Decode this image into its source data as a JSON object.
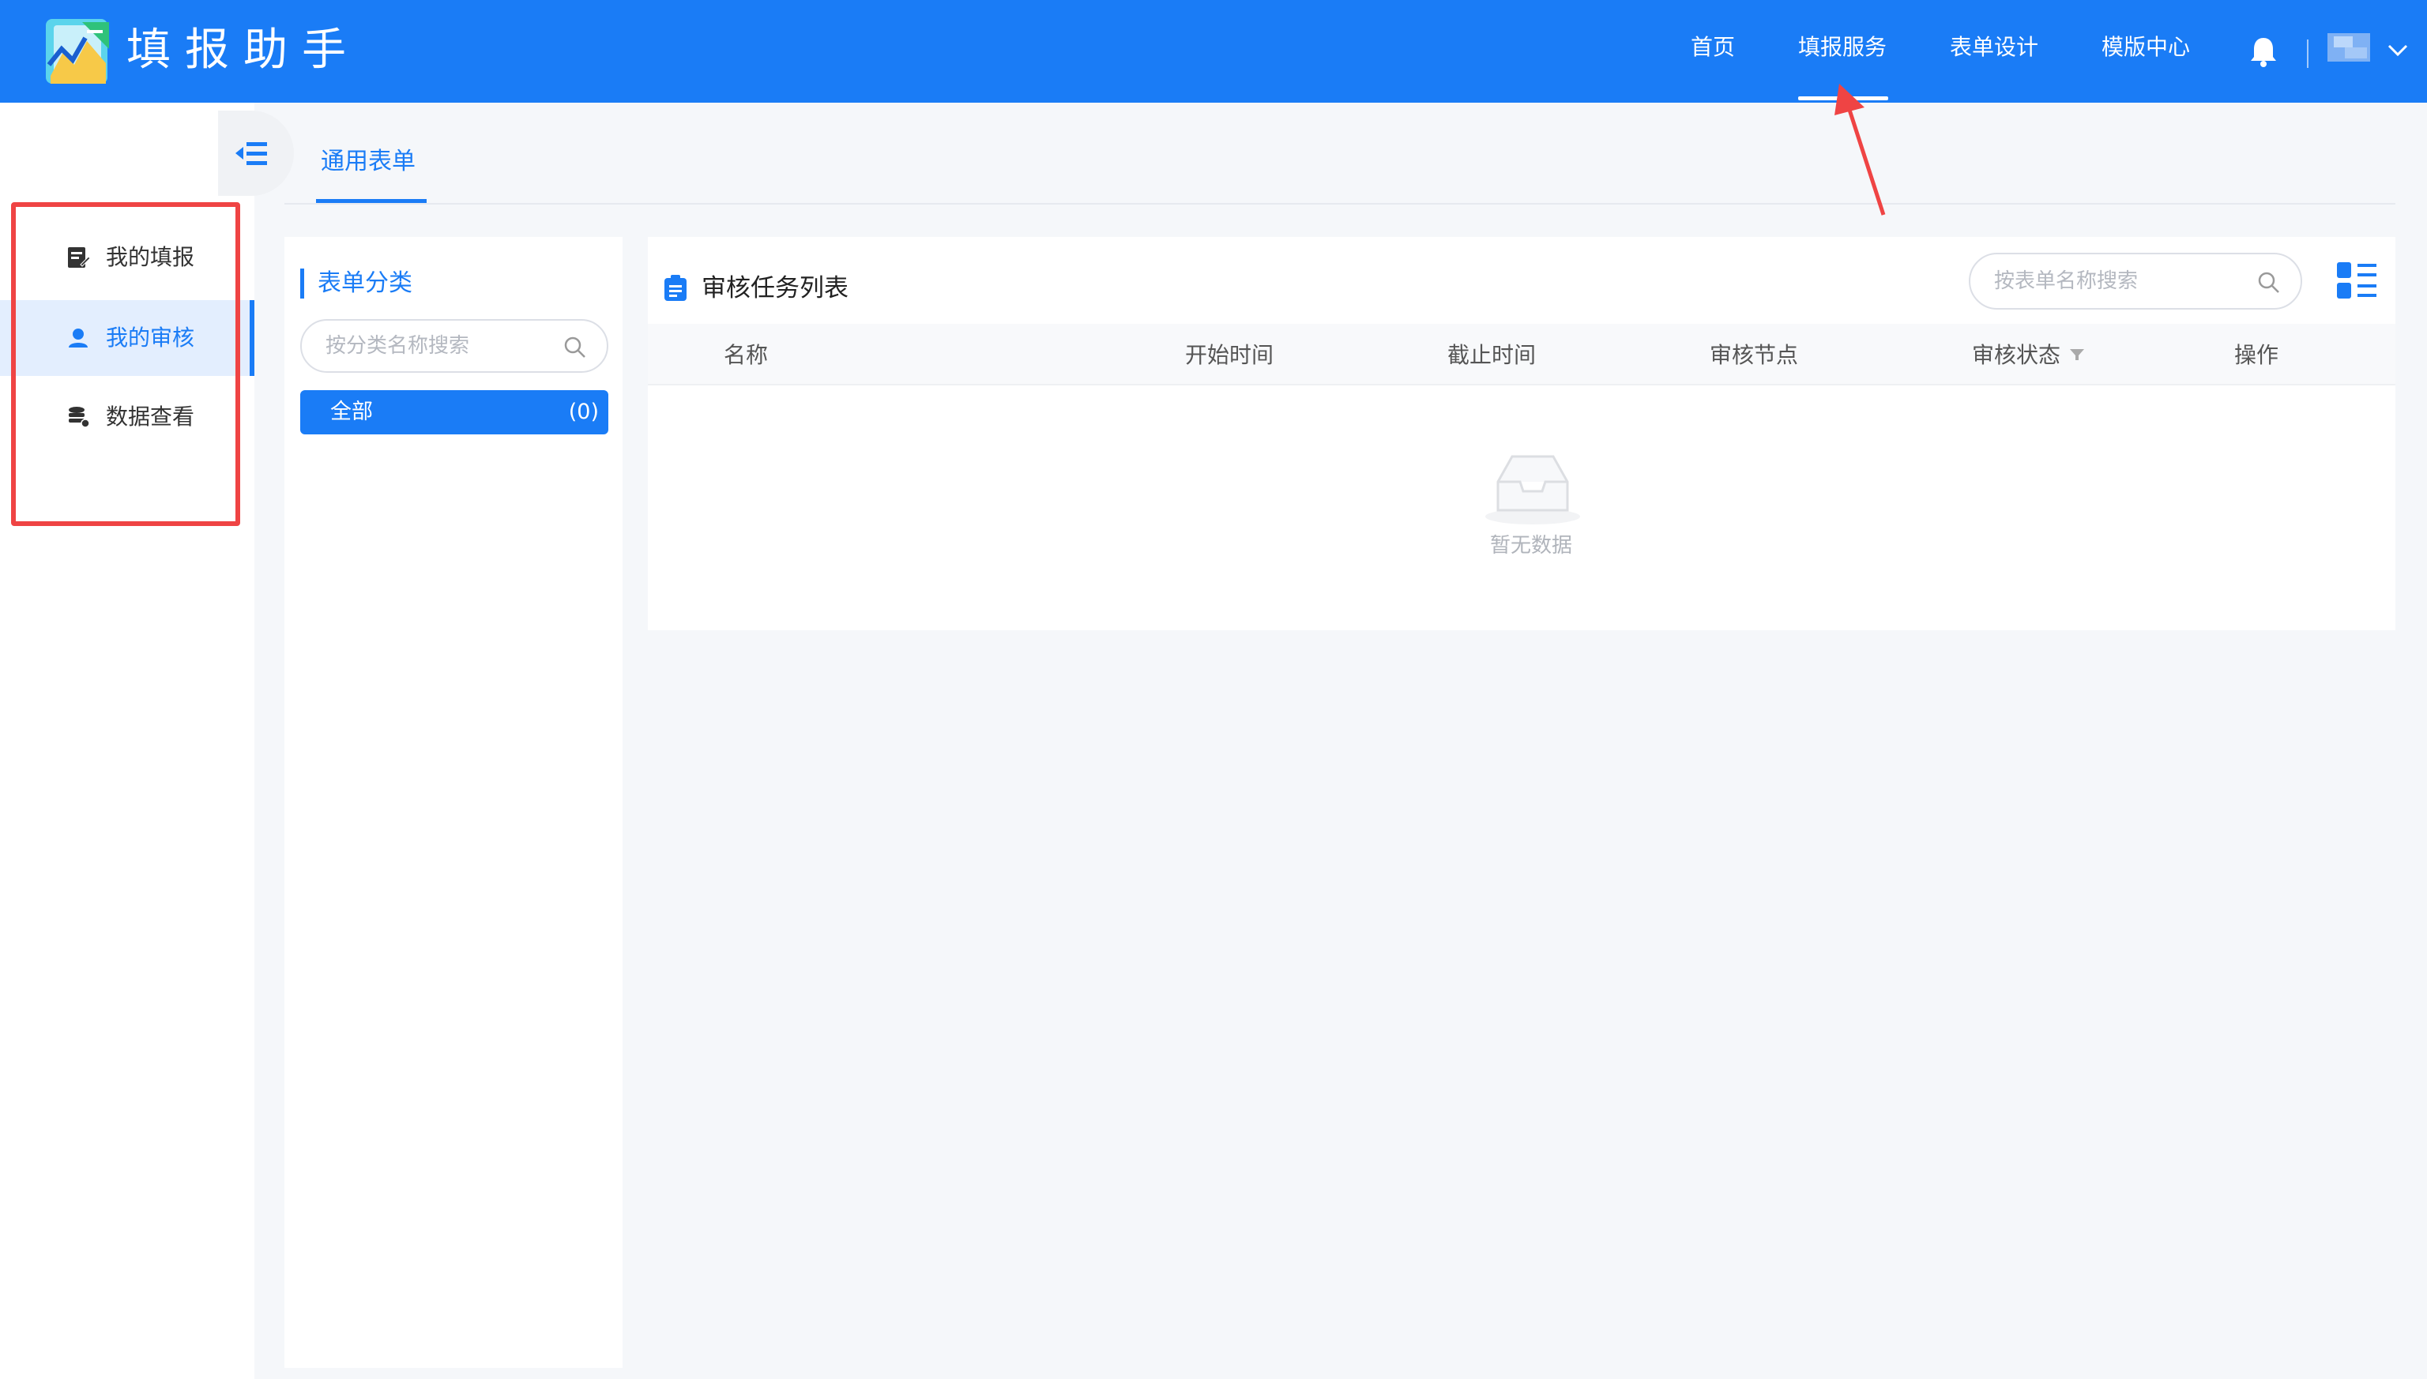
{
  "header": {
    "app_title": "填报助手",
    "nav": [
      "首页",
      "填报服务",
      "表单设计",
      "模版中心"
    ],
    "active_nav": "填报服务",
    "accent_color": "#1a7cf6"
  },
  "sidebar": {
    "items": [
      {
        "label": "我的填报",
        "icon": "form-edit-icon"
      },
      {
        "label": "我的审核",
        "icon": "user-icon"
      },
      {
        "label": "数据查看",
        "icon": "database-icon"
      }
    ],
    "active_index": 1
  },
  "tabs": [
    "通用表单"
  ],
  "category": {
    "title": "表单分类",
    "search_placeholder": "按分类名称搜索",
    "all_label": "全部",
    "all_count": "(0)"
  },
  "task_list": {
    "title": "审核任务列表",
    "search_placeholder": "按表单名称搜索",
    "columns": [
      "名称",
      "开始时间",
      "截止时间",
      "审核节点",
      "审核状态",
      "操作"
    ],
    "rows": [],
    "empty_text": "暂无数据"
  }
}
